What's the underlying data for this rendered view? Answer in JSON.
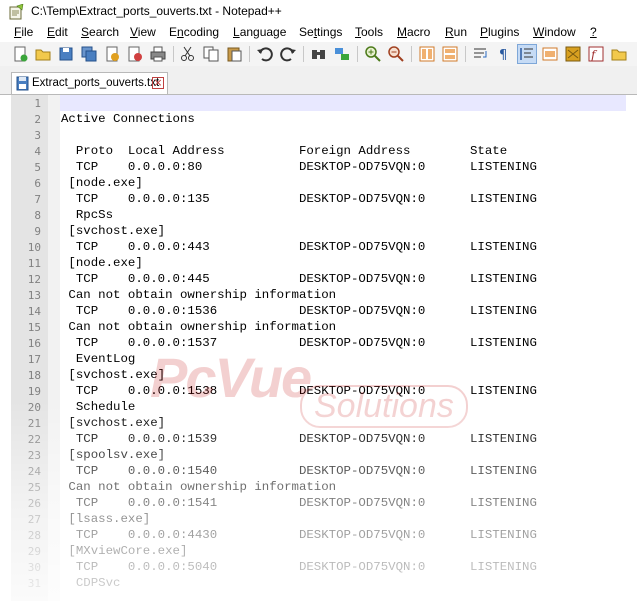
{
  "window": {
    "title": "C:\\Temp\\Extract_ports_ouverts.txt - Notepad++"
  },
  "menu": [
    {
      "label": "File",
      "u": "F",
      "rest": "ile"
    },
    {
      "label": "Edit",
      "u": "E",
      "rest": "dit"
    },
    {
      "label": "Search",
      "u": "S",
      "rest": "earch"
    },
    {
      "label": "View",
      "u": "V",
      "rest": "iew"
    },
    {
      "label": "Encoding",
      "u": "",
      "rest": "Encoding",
      "pre": "E",
      "mid": "n",
      "post": "coding"
    },
    {
      "label": "Language",
      "u": "L",
      "rest": "anguage"
    },
    {
      "label": "Settings",
      "u": "",
      "rest": "Settings",
      "pre": "Se",
      "mid": "t",
      "post": "tings"
    },
    {
      "label": "Tools",
      "u": "T",
      "rest": "ools"
    },
    {
      "label": "Macro",
      "u": "M",
      "rest": "acro"
    },
    {
      "label": "Run",
      "u": "R",
      "rest": "un"
    },
    {
      "label": "Plugins",
      "u": "P",
      "rest": "lugins"
    },
    {
      "label": "Window",
      "u": "W",
      "rest": "indow"
    },
    {
      "label": "?",
      "u": "?",
      "rest": ""
    }
  ],
  "tab": {
    "label": "Extract_ports_ouverts.txt"
  },
  "editor": {
    "current_line": 1,
    "lines": [
      {
        "n": "1",
        "t": ""
      },
      {
        "n": "2",
        "t": "Active Connections"
      },
      {
        "n": "3",
        "t": ""
      },
      {
        "n": "4",
        "t": "  Proto  Local Address          Foreign Address        State"
      },
      {
        "n": "5",
        "t": "  TCP    0.0.0.0:80             DESKTOP-OD75VQN:0      LISTENING"
      },
      {
        "n": "6",
        "t": " [node.exe]"
      },
      {
        "n": "7",
        "t": "  TCP    0.0.0.0:135            DESKTOP-OD75VQN:0      LISTENING"
      },
      {
        "n": "8",
        "t": "  RpcSs"
      },
      {
        "n": "9",
        "t": " [svchost.exe]"
      },
      {
        "n": "10",
        "t": "  TCP    0.0.0.0:443            DESKTOP-OD75VQN:0      LISTENING"
      },
      {
        "n": "11",
        "t": " [node.exe]"
      },
      {
        "n": "12",
        "t": "  TCP    0.0.0.0:445            DESKTOP-OD75VQN:0      LISTENING"
      },
      {
        "n": "13",
        "t": " Can not obtain ownership information"
      },
      {
        "n": "14",
        "t": "  TCP    0.0.0.0:1536           DESKTOP-OD75VQN:0      LISTENING"
      },
      {
        "n": "15",
        "t": " Can not obtain ownership information"
      },
      {
        "n": "16",
        "t": "  TCP    0.0.0.0:1537           DESKTOP-OD75VQN:0      LISTENING"
      },
      {
        "n": "17",
        "t": "  EventLog"
      },
      {
        "n": "18",
        "t": " [svchost.exe]"
      },
      {
        "n": "19",
        "t": "  TCP    0.0.0.0:1538           DESKTOP-OD75VQN:0      LISTENING"
      },
      {
        "n": "20",
        "t": "  Schedule"
      },
      {
        "n": "21",
        "t": " [svchost.exe]"
      },
      {
        "n": "22",
        "t": "  TCP    0.0.0.0:1539           DESKTOP-OD75VQN:0      LISTENING"
      },
      {
        "n": "23",
        "t": " [spoolsv.exe]"
      },
      {
        "n": "24",
        "t": "  TCP    0.0.0.0:1540           DESKTOP-OD75VQN:0      LISTENING"
      },
      {
        "n": "25",
        "t": " Can not obtain ownership information"
      },
      {
        "n": "26",
        "t": "  TCP    0.0.0.0:1541           DESKTOP-OD75VQN:0      LISTENING"
      },
      {
        "n": "27",
        "t": " [lsass.exe]"
      },
      {
        "n": "28",
        "t": "  TCP    0.0.0.0:4430           DESKTOP-OD75VQN:0      LISTENING"
      },
      {
        "n": "29",
        "t": " [MXviewCore.exe]"
      },
      {
        "n": "30",
        "t": "  TCP    0.0.0.0:5040           DESKTOP-OD75VQN:0      LISTENING"
      },
      {
        "n": "31",
        "t": "  CDPSvc"
      }
    ]
  },
  "watermark": {
    "logo": "PcVue",
    "sub": "Solutions"
  },
  "colors": {
    "current_line_bg": "#e8e8ff",
    "gutter_bg": "#e4e4e4",
    "watermark": "#c00000"
  }
}
